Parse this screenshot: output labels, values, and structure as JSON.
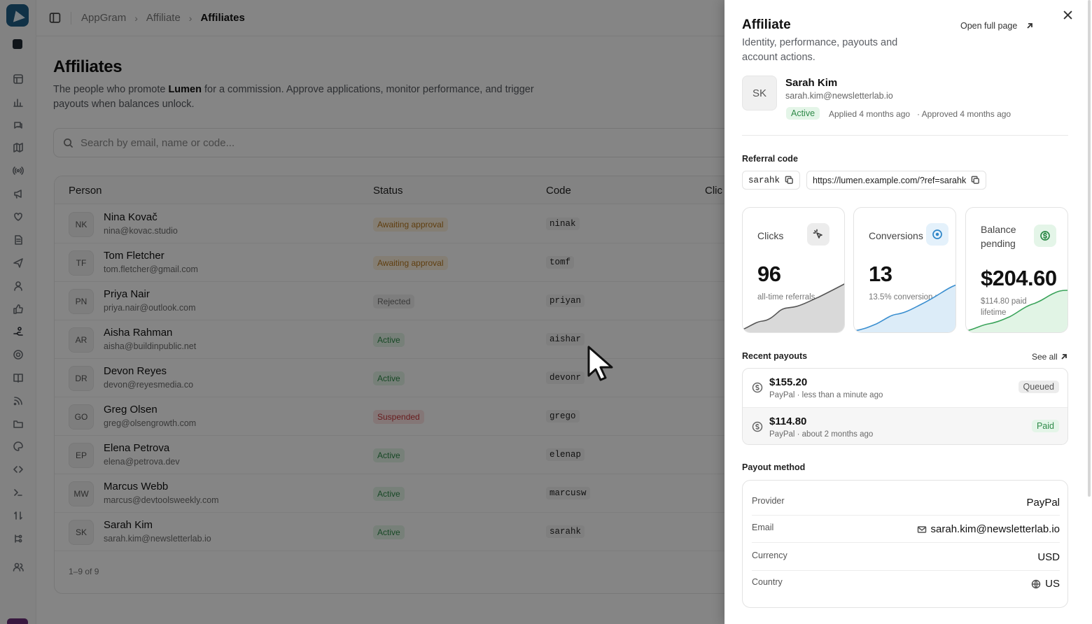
{
  "breadcrumb": [
    "AppGram",
    "Affiliate",
    "Affiliates"
  ],
  "page": {
    "title": "Affiliates",
    "subtitle_pre": "The people who promote ",
    "subtitle_brand": "Lumen",
    "subtitle_post": " for a commission. Approve applications, monitor performance, and trigger payouts when balances unlock."
  },
  "search": {
    "placeholder": "Search by email, name or code..."
  },
  "table": {
    "columns": [
      "Person",
      "Status",
      "Code",
      "Clic"
    ],
    "rows": [
      {
        "initials": "NK",
        "name": "Nina Kovač",
        "email": "nina@kovac.studio",
        "status": "Awaiting approval",
        "code": "ninak"
      },
      {
        "initials": "TF",
        "name": "Tom Fletcher",
        "email": "tom.fletcher@gmail.com",
        "status": "Awaiting approval",
        "code": "tomf"
      },
      {
        "initials": "PN",
        "name": "Priya Nair",
        "email": "priya.nair@outlook.com",
        "status": "Rejected",
        "code": "priyan"
      },
      {
        "initials": "AR",
        "name": "Aisha Rahman",
        "email": "aisha@buildinpublic.net",
        "status": "Active",
        "code": "aishar"
      },
      {
        "initials": "DR",
        "name": "Devon Reyes",
        "email": "devon@reyesmedia.co",
        "status": "Active",
        "code": "devonr"
      },
      {
        "initials": "GO",
        "name": "Greg Olsen",
        "email": "greg@olsengrowth.com",
        "status": "Suspended",
        "code": "grego"
      },
      {
        "initials": "EP",
        "name": "Elena Petrova",
        "email": "elena@petrova.dev",
        "status": "Active",
        "code": "elenap"
      },
      {
        "initials": "MW",
        "name": "Marcus Webb",
        "email": "marcus@devtoolsweekly.com",
        "status": "Active",
        "code": "marcusw"
      },
      {
        "initials": "SK",
        "name": "Sarah Kim",
        "email": "sarah.kim@newsletterlab.io",
        "status": "Active",
        "code": "sarahk"
      }
    ],
    "pagination": "1–9 of 9"
  },
  "panel": {
    "title": "Affiliate",
    "description": "Identity, performance, payouts and account actions.",
    "open_full": "Open full page",
    "person": {
      "initials": "SK",
      "name": "Sarah Kim",
      "email": "sarah.kim@newsletterlab.io",
      "status": "Active",
      "applied": "Applied 4 months ago",
      "approved": "· Approved 4 months ago"
    },
    "referral": {
      "label": "Referral code",
      "code": "sarahk",
      "link": "https://lumen.example.com/?ref=sarahk"
    },
    "stats": {
      "clicks": {
        "label": "Clicks",
        "value": "96",
        "sub": "all-time referrals"
      },
      "conversions": {
        "label": "Conversions",
        "value": "13",
        "sub": "13.5% conversion rate"
      },
      "balance": {
        "label": "Balance pending",
        "value": "$204.60",
        "sub": "$114.80 paid lifetime"
      }
    },
    "payouts": {
      "label": "Recent payouts",
      "see_all": "See all",
      "items": [
        {
          "amount": "$155.20",
          "meta": "PayPal · less than a minute ago",
          "status": "Queued"
        },
        {
          "amount": "$114.80",
          "meta": "PayPal · about 2 months ago",
          "status": "Paid"
        }
      ]
    },
    "method": {
      "label": "Payout method",
      "rows": [
        {
          "key": "Provider",
          "value": "PayPal"
        },
        {
          "key": "Email",
          "value": "sarah.kim@newsletterlab.io"
        },
        {
          "key": "Currency",
          "value": "USD"
        },
        {
          "key": "Country",
          "value": "US"
        }
      ]
    }
  },
  "colors": {
    "awaiting": "#b7771d",
    "active": "#2f8a49",
    "suspended": "#c8393c",
    "rejected": "#6d6d6d",
    "brand": "#1f5f86"
  },
  "icons": [
    "sidebar-toggle-icon",
    "search-icon",
    "close-icon",
    "external-link-icon",
    "copy-icon",
    "cursor-click-icon",
    "target-icon",
    "dollar-circle-icon",
    "mail-icon",
    "globe-icon"
  ]
}
